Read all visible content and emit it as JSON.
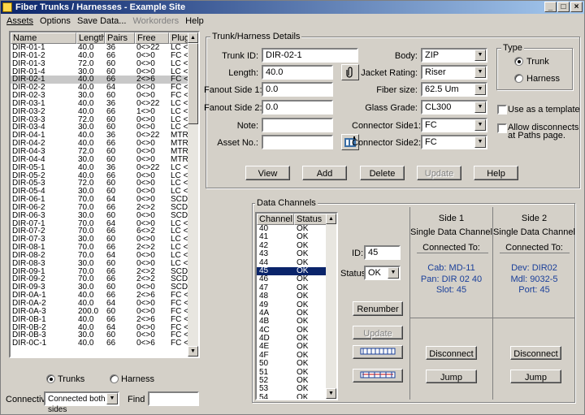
{
  "window": {
    "title": "Fiber Trunks / Harnesses - Example Site"
  },
  "menu": [
    {
      "label": "Assets",
      "disabled": false
    },
    {
      "label": "Options",
      "disabled": false
    },
    {
      "label": "Save Data...",
      "disabled": false
    },
    {
      "label": "Workorders",
      "disabled": true
    },
    {
      "label": "Help",
      "disabled": false
    }
  ],
  "trunk_list": {
    "columns": [
      "Name",
      "Length",
      "Pairs",
      "Free",
      "Plugs"
    ],
    "rows": [
      [
        "DIR-01-1",
        "40.0",
        "36",
        "0<>22",
        "LC  <"
      ],
      [
        "DIR-01-2",
        "40.0",
        "66",
        "0<>0",
        "FC  <"
      ],
      [
        "DIR-01-3",
        "72.0",
        "60",
        "0<>0",
        "LC  <"
      ],
      [
        "DIR-01-4",
        "30.0",
        "60",
        "0<>0",
        "LC  <"
      ],
      [
        "DIR-02-1",
        "40.0",
        "66",
        "2<>6",
        "FC  <"
      ],
      [
        "DIR-02-2",
        "40.0",
        "64",
        "0<>0",
        "FC  <"
      ],
      [
        "DIR-02-3",
        "30.0",
        "60",
        "0<>0",
        "FC  <"
      ],
      [
        "DIR-03-1",
        "40.0",
        "36",
        "0<>22",
        "LC  <"
      ],
      [
        "DIR-03-2",
        "40.0",
        "66",
        "1<>0",
        "LC  <"
      ],
      [
        "DIR-03-3",
        "72.0",
        "60",
        "0<>0",
        "LC  <"
      ],
      [
        "DIR-03-4",
        "30.0",
        "60",
        "0<>0",
        "LC  <"
      ],
      [
        "DIR-04-1",
        "40.0",
        "36",
        "0<>22",
        "MTRJ"
      ],
      [
        "DIR-04-2",
        "40.0",
        "66",
        "0<>0",
        "MTRJ"
      ],
      [
        "DIR-04-3",
        "72.0",
        "60",
        "0<>0",
        "MTRJ"
      ],
      [
        "DIR-04-4",
        "30.0",
        "60",
        "0<>0",
        "MTRJ"
      ],
      [
        "DIR-05-1",
        "40.0",
        "36",
        "0<>22",
        "LC  <"
      ],
      [
        "DIR-05-2",
        "40.0",
        "66",
        "0<>0",
        "LC  <"
      ],
      [
        "DIR-05-3",
        "72.0",
        "60",
        "0<>0",
        "LC  <"
      ],
      [
        "DIR-05-4",
        "30.0",
        "60",
        "0<>0",
        "LC  <"
      ],
      [
        "DIR-06-1",
        "70.0",
        "64",
        "0<>0",
        "SCDC"
      ],
      [
        "DIR-06-2",
        "70.0",
        "66",
        "2<>2",
        "SCDC"
      ],
      [
        "DIR-06-3",
        "30.0",
        "60",
        "0<>0",
        "SCDC"
      ],
      [
        "DIR-07-1",
        "70.0",
        "64",
        "0<>0",
        "LC  <"
      ],
      [
        "DIR-07-2",
        "70.0",
        "66",
        "6<>2",
        "LC  <"
      ],
      [
        "DIR-07-3",
        "30.0",
        "60",
        "0<>0",
        "LC  <"
      ],
      [
        "DIR-08-1",
        "70.0",
        "66",
        "2<>2",
        "LC  <"
      ],
      [
        "DIR-08-2",
        "70.0",
        "64",
        "0<>0",
        "LC  <"
      ],
      [
        "DIR-08-3",
        "30.0",
        "60",
        "0<>0",
        "LC  <"
      ],
      [
        "DIR-09-1",
        "70.0",
        "66",
        "2<>2",
        "SCDC"
      ],
      [
        "DIR-09-2",
        "70.0",
        "66",
        "2<>2",
        "SCDC"
      ],
      [
        "DIR-09-3",
        "30.0",
        "60",
        "0<>0",
        "SCDC"
      ],
      [
        "DIR-0A-1",
        "40.0",
        "66",
        "2<>6",
        "FC  <"
      ],
      [
        "DIR-0A-2",
        "40.0",
        "64",
        "0<>0",
        "FC  <"
      ],
      [
        "DIR-0A-3",
        "200.0",
        "60",
        "0<>0",
        "FC  <"
      ],
      [
        "DIR-0B-1",
        "40.0",
        "66",
        "2<>6",
        "FC  <"
      ],
      [
        "DIR-0B-2",
        "40.0",
        "64",
        "0<>0",
        "FC  <"
      ],
      [
        "DIR-0B-3",
        "30.0",
        "60",
        "0<>0",
        "FC  <"
      ],
      [
        "DIR-0C-1",
        "40.0",
        "66",
        "0<>6",
        "FC  <"
      ]
    ],
    "selected_index": 4
  },
  "type_filter": {
    "trunks_label": "Trunks",
    "harness_label": "Harness",
    "selected": "Trunks"
  },
  "connectivity": {
    "label": "Connectivity:",
    "value": "Connected both sides"
  },
  "find": {
    "label": "Find :",
    "value": ""
  },
  "details": {
    "group_title": "Trunk/Harness Details",
    "trunk_id_label": "Trunk ID:",
    "trunk_id": "DIR-02-1",
    "length_label": "Length:",
    "length": "40.0",
    "fanout1_label": "Fanout Side 1:",
    "fanout1": "0.0",
    "fanout2_label": "Fanout Side 2:",
    "fanout2": "0.0",
    "note_label": "Note:",
    "note": "",
    "asset_label": "Asset No.:",
    "asset": "",
    "body_label": "Body:",
    "body": "ZIP",
    "jacket_label": "Jacket Rating:",
    "jacket": "Riser",
    "fiber_label": "Fiber size:",
    "fiber": "62.5 Um",
    "glass_label": "Glass Grade:",
    "glass": "CL300",
    "conn1_label": "Connector Side1:",
    "conn1": "FC",
    "conn2_label": "Connector Side2:",
    "conn2": "FC",
    "type_title": "Type",
    "type_trunk": "Trunk",
    "type_harness": "Harness",
    "type_selected": "Trunk",
    "template_label": "Use as a template",
    "allow_label_1": "Allow disconnects",
    "allow_label_2": "at Paths page.",
    "buttons": {
      "view": "View",
      "add": "Add",
      "delete": "Delete",
      "update": "Update",
      "help": "Help"
    }
  },
  "channels": {
    "group_title": "Data Channels",
    "columns": [
      "Channel",
      "Status"
    ],
    "rows": [
      [
        "40",
        "OK"
      ],
      [
        "41",
        "OK"
      ],
      [
        "42",
        "OK"
      ],
      [
        "43",
        "OK"
      ],
      [
        "44",
        "OK"
      ],
      [
        "45",
        "OK"
      ],
      [
        "46",
        "OK"
      ],
      [
        "47",
        "OK"
      ],
      [
        "48",
        "OK"
      ],
      [
        "49",
        "OK"
      ],
      [
        "4A",
        "OK"
      ],
      [
        "4B",
        "OK"
      ],
      [
        "4C",
        "OK"
      ],
      [
        "4D",
        "OK"
      ],
      [
        "4E",
        "OK"
      ],
      [
        "4F",
        "OK"
      ],
      [
        "50",
        "OK"
      ],
      [
        "51",
        "OK"
      ],
      [
        "52",
        "OK"
      ],
      [
        "53",
        "OK"
      ],
      [
        "54",
        "OK"
      ]
    ],
    "selected_index": 5,
    "id_label": "ID:",
    "id": "45",
    "status_label": "Status:",
    "status": "OK",
    "renumber": "Renumber",
    "update": "Update"
  },
  "side1": {
    "title": "Side 1",
    "subtitle": "Single Data Channel",
    "connected_to": "Connected To:",
    "line1": "Cab: MD-11",
    "line2": "Pan: DIR 02 40",
    "line3": "Slot: 45",
    "disconnect": "Disconnect",
    "jump": "Jump"
  },
  "side2": {
    "title": "Side 2",
    "subtitle": "Single Data Channel",
    "connected_to": "Connected To:",
    "line1": "Dev: DIR02",
    "line2": "Mdl: 9032-5",
    "line3": "Port: 45",
    "disconnect": "Disconnect",
    "jump": "Jump"
  }
}
